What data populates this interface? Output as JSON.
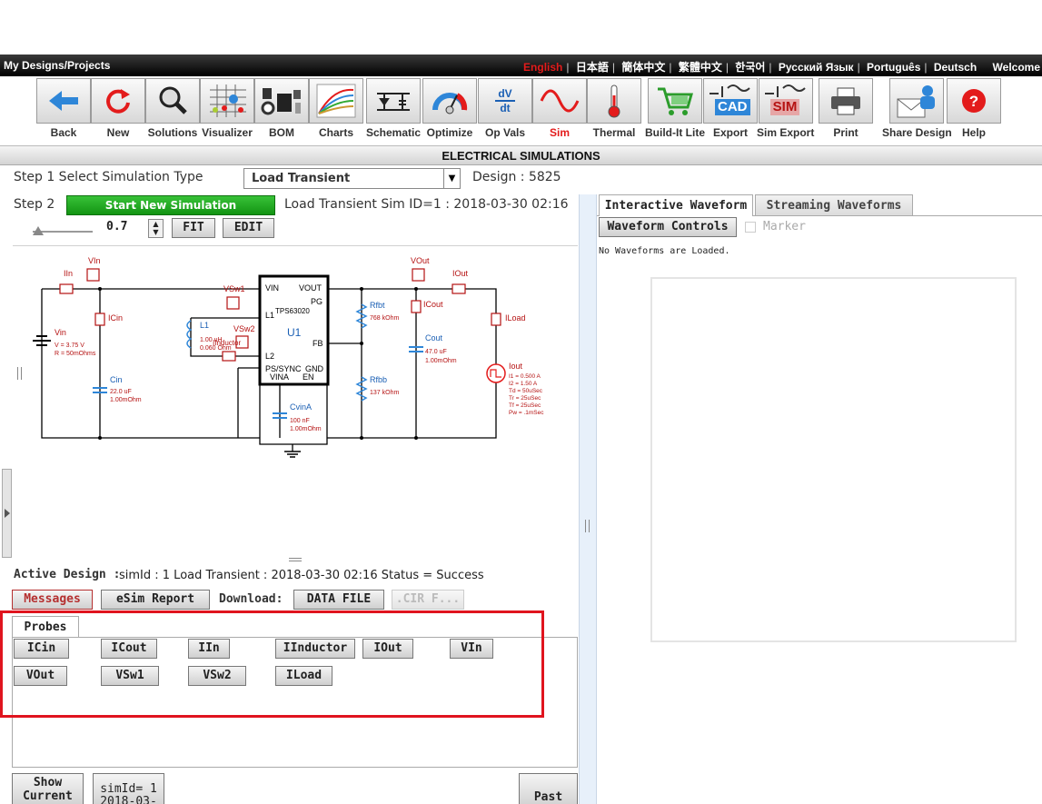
{
  "topbar": {
    "left_link": "My Designs/Projects",
    "languages": [
      "English",
      "日本語",
      "簡体中文",
      "繁體中文",
      "한국어",
      "Русский Язык",
      "Português",
      "Deutsch"
    ],
    "active_language": "English",
    "welcome": "Welcome"
  },
  "toolbar": {
    "items": [
      {
        "label": "Back",
        "icon": "back-arrow-icon"
      },
      {
        "label": "New",
        "icon": "refresh-icon"
      },
      {
        "label": "Solutions",
        "icon": "magnifier-icon"
      },
      {
        "label": "Visualizer",
        "icon": "visualizer-grid-icon"
      },
      {
        "label": "BOM",
        "icon": "components-icon"
      },
      {
        "label": "Charts",
        "icon": "chart-curves-icon"
      },
      {
        "label": "Schematic",
        "icon": "schematic-icon"
      },
      {
        "label": "Optimize",
        "icon": "gauge-icon"
      },
      {
        "label": "Op Vals",
        "icon": "dv-dt-icon"
      },
      {
        "label": "Sim",
        "icon": "sine-wave-icon"
      },
      {
        "label": "Thermal",
        "icon": "thermometer-icon"
      },
      {
        "label": "Build-It Lite",
        "icon": "shopping-cart-icon"
      },
      {
        "label": "Export",
        "icon": "cad-export-icon"
      },
      {
        "label": "Sim Export",
        "icon": "sim-export-icon"
      },
      {
        "label": "Print",
        "icon": "printer-icon"
      },
      {
        "label": "Share Design",
        "icon": "share-envelope-icon"
      },
      {
        "label": "Help",
        "icon": "help-icon"
      }
    ],
    "active": "Sim",
    "dv_top": "dV",
    "dv_bottom": "dt",
    "cad_text": "CAD",
    "sim_text": "SIM"
  },
  "section_title": "ELECTRICAL SIMULATIONS",
  "step1": {
    "label": "Step 1 Select Simulation Type",
    "selected": "Load Transient",
    "design": "Design : 5825"
  },
  "step2": {
    "label": "Step 2",
    "start_button": "Start New Simulation",
    "sim_info": "Load Transient Sim ID=1 : 2018-03-30 02:16",
    "zoom_value": "0.7",
    "fit_button": "FIT",
    "edit_button": "EDIT"
  },
  "schematic": {
    "labels": {
      "iin": "IIn",
      "vin_probe": "VIn",
      "vsw1": "VSw1",
      "vsw2": "VSw2",
      "vout_probe": "VOut",
      "iout": "IOut",
      "icin": "ICin",
      "icout": "ICout",
      "iload": "ILoad",
      "vin": "Vin",
      "vin_v": "V = 3.75 V",
      "vin_r": "R = 50mOhms",
      "cin": "Cin",
      "cin_c": "22.0 uF",
      "cin_r": "1.00mOhm",
      "l1": "L1",
      "l1_l": "1.00 uH",
      "l1_r": "0.060 Ohm",
      "iinductor": "IInductor",
      "u1": "U1",
      "chip": "TPS63020",
      "pin_vin": "VIN",
      "pin_vout": "VOUT",
      "pin_pg": "PG",
      "pin_l1": "L1",
      "pin_l2": "L2",
      "pin_fb": "FB",
      "pin_ps": "PS/SYNC",
      "pin_gnd": "GND",
      "pin_vina": "VINA",
      "pin_en": "EN",
      "cvina": "CvinA",
      "cvina_c": "100 nF",
      "cvina_r": "1.00mOhm",
      "rfbt": "Rfbt",
      "rfbt_v": "768 kOhm",
      "rfbb": "Rfbb",
      "rfbb_v": "137 kOhm",
      "cout": "Cout",
      "cout_c": "47.0 uF",
      "cout_r": "1.00mOhm",
      "iout_src": "Iout",
      "i1": "I1 = 0.500 A",
      "i2": "I2 = 1.50 A",
      "td": "Td = 50uSec",
      "tr": "Tr = 25uSec",
      "tf": "Tf = 25uSec",
      "pw": "Pw = .1mSec"
    }
  },
  "active_design": {
    "label": "Active Design :",
    "text": "simId : 1 Load Transient : 2018-03-30 02:16 Status = Success"
  },
  "actions": {
    "messages": "Messages",
    "esim_report": "eSim Report",
    "download_label": "Download:",
    "data_file": "DATA FILE",
    "cir_file": ".CIR F..."
  },
  "probes": {
    "tab": "Probes",
    "buttons": [
      "ICin",
      "ICout",
      "IIn",
      "IInductor",
      "IOut",
      "VIn",
      "VOut",
      "VSw1",
      "VSw2",
      "ILoad"
    ]
  },
  "bottom": {
    "show_current_1": "Show",
    "show_current_2": "Current",
    "simid_1": "simId= 1",
    "simid_2": "2018-03-",
    "past": "Past"
  },
  "waveform": {
    "tabs": [
      "Interactive Waveform",
      "Streaming Waveforms"
    ],
    "controls_button": "Waveform Controls",
    "marker_label": "Marker",
    "empty_message": "No Waveforms are Loaded."
  },
  "colors": {
    "accent_red": "#e31b1b",
    "start_green": "#1fa81f",
    "highlight_red": "#e0141e"
  }
}
